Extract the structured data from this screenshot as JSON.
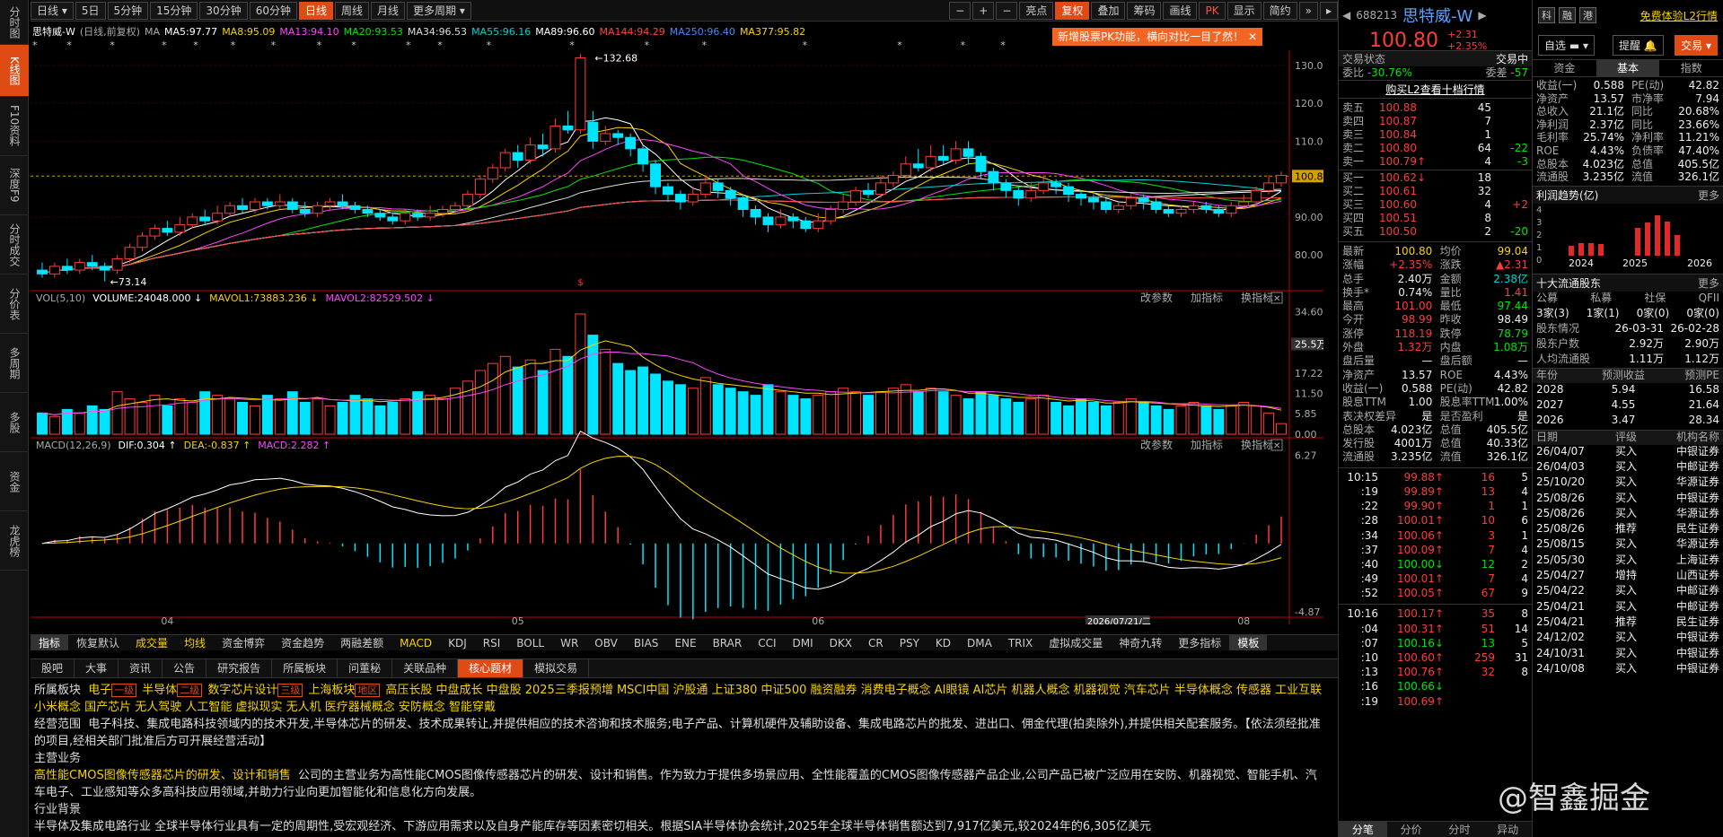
{
  "left_rail": [
    "分时图",
    "K线图",
    "F10资料",
    "深度F9",
    "分时成交",
    "分价表",
    "多周期",
    "多股",
    "资金",
    "龙虎榜"
  ],
  "toolbar": {
    "items": [
      "日线",
      "5日",
      "5分钟",
      "15分钟",
      "30分钟",
      "60分钟",
      "日线",
      "周线",
      "月线",
      "更多周期"
    ],
    "right": [
      "亮点",
      "复权",
      "叠加",
      "筹码",
      "画线",
      "PK",
      "显示",
      "简约"
    ]
  },
  "period_select": "日线",
  "stock": {
    "code": "688213",
    "name": "思特威-W",
    "price": "100.80",
    "change": "+2.31",
    "pct": "+2.35%"
  },
  "ma_line": [
    {
      "t": "思特威-W",
      "c": "#ffffff"
    },
    {
      "t": "(日线,前复权)",
      "c": "#aaaaaa"
    },
    {
      "t": "MA",
      "c": "#aaaaaa"
    },
    {
      "t": "MA5:97.77",
      "c": "#ffffff"
    },
    {
      "t": "MA8:95.09",
      "c": "#f5d300"
    },
    {
      "t": "MA13:94.10",
      "c": "#ff44ff"
    },
    {
      "t": "MA20:93.53",
      "c": "#00e600"
    },
    {
      "t": "MA34:96.53",
      "c": "#dddddd"
    },
    {
      "t": "MA55:96.16",
      "c": "#00d5d5"
    },
    {
      "t": "MA89:96.60",
      "c": "#ffffff"
    },
    {
      "t": "MA144:94.29",
      "c": "#ff4444"
    },
    {
      "t": "MA250:96.40",
      "c": "#4488ff"
    },
    {
      "t": "MA377:95.82",
      "c": "#f5d300"
    }
  ],
  "tip": "新增股票PK功能，横向对比一目了然！",
  "price_axis": [
    "130.00",
    "120.00",
    "110.00",
    "100.80",
    "90.00",
    "80.00"
  ],
  "hi_label": "132.68",
  "lo_label": "73.14",
  "vol_head": {
    "name": "VOL(5,10)",
    "volume": "VOLUME:24048.000",
    "m1": "MAVOL1:73883.236",
    "m2": "MAVOL2:82529.502"
  },
  "vol_axis": [
    "34.60",
    "25.5万",
    "17.22",
    "11.50",
    "5.85",
    "0.00"
  ],
  "macd_head": {
    "name": "MACD(12,26,9)",
    "dif": "DIF:0.304",
    "dea": "DEA:-0.837",
    "macd": "MACD:2.282"
  },
  "macd_axis": [
    "6.27",
    "-4.87"
  ],
  "panel_btns": [
    "改参数",
    "加指标",
    "换指标"
  ],
  "x_axis": [
    "04",
    "05",
    "06",
    "07",
    "08"
  ],
  "cursor_date": "2026/07/21/二",
  "chart_data": {
    "type": "candlestick",
    "ylim": [
      72,
      134
    ],
    "candles": [
      [
        76,
        75,
        78,
        74
      ],
      [
        75,
        77,
        78,
        74
      ],
      [
        77,
        76,
        79,
        75
      ],
      [
        76,
        78,
        79,
        75
      ],
      [
        78,
        77,
        80,
        76
      ],
      [
        77,
        76,
        78,
        73
      ],
      [
        76,
        79,
        80,
        75
      ],
      [
        79,
        82,
        83,
        78
      ],
      [
        82,
        85,
        86,
        81
      ],
      [
        85,
        87,
        88,
        84
      ],
      [
        87,
        86,
        89,
        85
      ],
      [
        86,
        88,
        90,
        85
      ],
      [
        88,
        90,
        91,
        87
      ],
      [
        90,
        89,
        92,
        88
      ],
      [
        89,
        91,
        93,
        88
      ],
      [
        91,
        93,
        94,
        90
      ],
      [
        93,
        92,
        95,
        91
      ],
      [
        92,
        94,
        95,
        91
      ],
      [
        94,
        93,
        95,
        92
      ],
      [
        93,
        94,
        96,
        92
      ],
      [
        94,
        92,
        95,
        91
      ],
      [
        92,
        91,
        94,
        90
      ],
      [
        91,
        93,
        94,
        90
      ],
      [
        93,
        94,
        95,
        92
      ],
      [
        94,
        93,
        96,
        92
      ],
      [
        93,
        92,
        94,
        91
      ],
      [
        92,
        91,
        93,
        90
      ],
      [
        91,
        90,
        92,
        89
      ],
      [
        90,
        89,
        91,
        88
      ],
      [
        89,
        91,
        92,
        88
      ],
      [
        91,
        90,
        92,
        89
      ],
      [
        90,
        91,
        93,
        89
      ],
      [
        91,
        92,
        93,
        90
      ],
      [
        92,
        93,
        94,
        91
      ],
      [
        93,
        96,
        97,
        92
      ],
      [
        96,
        100,
        101,
        95
      ],
      [
        100,
        103,
        104,
        99
      ],
      [
        103,
        107,
        108,
        102
      ],
      [
        107,
        105,
        109,
        103
      ],
      [
        105,
        109,
        111,
        104
      ],
      [
        109,
        108,
        112,
        106
      ],
      [
        108,
        114,
        116,
        107
      ],
      [
        114,
        113,
        118,
        112
      ],
      [
        113,
        132,
        133,
        112
      ],
      [
        115,
        110,
        118,
        108
      ],
      [
        110,
        112,
        114,
        109
      ],
      [
        112,
        111,
        113,
        109
      ],
      [
        111,
        108,
        112,
        106
      ],
      [
        108,
        104,
        109,
        102
      ],
      [
        104,
        98,
        105,
        96
      ],
      [
        98,
        96,
        99,
        94
      ],
      [
        96,
        94,
        97,
        92
      ],
      [
        94,
        96,
        98,
        93
      ],
      [
        96,
        99,
        101,
        95
      ],
      [
        99,
        97,
        100,
        95
      ],
      [
        97,
        95,
        98,
        93
      ],
      [
        95,
        92,
        96,
        90
      ],
      [
        92,
        90,
        93,
        88
      ],
      [
        90,
        88,
        91,
        86
      ],
      [
        88,
        90,
        92,
        87
      ],
      [
        90,
        89,
        91,
        87
      ],
      [
        89,
        87,
        90,
        86
      ],
      [
        87,
        89,
        91,
        86
      ],
      [
        89,
        92,
        93,
        88
      ],
      [
        92,
        94,
        96,
        91
      ],
      [
        94,
        97,
        98,
        93
      ],
      [
        97,
        96,
        99,
        95
      ],
      [
        96,
        99,
        101,
        95
      ],
      [
        99,
        101,
        102,
        98
      ],
      [
        101,
        104,
        106,
        100
      ],
      [
        104,
        103,
        108,
        102
      ],
      [
        103,
        106,
        109,
        102
      ],
      [
        106,
        105,
        109,
        104
      ],
      [
        105,
        108,
        110,
        104
      ],
      [
        108,
        106,
        110,
        104
      ],
      [
        106,
        102,
        107,
        100
      ],
      [
        102,
        99,
        103,
        97
      ],
      [
        99,
        97,
        100,
        95
      ],
      [
        97,
        95,
        98,
        93
      ],
      [
        95,
        97,
        99,
        94
      ],
      [
        97,
        99,
        101,
        96
      ],
      [
        99,
        98,
        100,
        96
      ],
      [
        98,
        96,
        99,
        94
      ],
      [
        96,
        95,
        97,
        93
      ],
      [
        95,
        94,
        96,
        92
      ],
      [
        94,
        92,
        95,
        91
      ],
      [
        92,
        93,
        94,
        91
      ],
      [
        93,
        95,
        96,
        92
      ],
      [
        95,
        94,
        96,
        92
      ],
      [
        94,
        92,
        95,
        91
      ],
      [
        92,
        91,
        93,
        90
      ],
      [
        91,
        92,
        93,
        90
      ],
      [
        92,
        93,
        94,
        91
      ],
      [
        93,
        92,
        94,
        91
      ],
      [
        92,
        91,
        93,
        90
      ],
      [
        91,
        93,
        94,
        90
      ],
      [
        93,
        94,
        96,
        92
      ],
      [
        94,
        97,
        98,
        93
      ],
      [
        97,
        99,
        101,
        96
      ],
      [
        99,
        101,
        102,
        98
      ]
    ],
    "vol": [
      6,
      5,
      7,
      6,
      8,
      7,
      12,
      10,
      9,
      11,
      8,
      10,
      9,
      12,
      11,
      10,
      9,
      8,
      11,
      10,
      12,
      9,
      10,
      8,
      9,
      11,
      10,
      8,
      9,
      10,
      12,
      11,
      10,
      13,
      15,
      18,
      20,
      22,
      19,
      21,
      18,
      24,
      22,
      34,
      28,
      24,
      20,
      18,
      19,
      17,
      15,
      14,
      13,
      16,
      14,
      13,
      12,
      11,
      14,
      12,
      11,
      10,
      11,
      12,
      13,
      12,
      11,
      12,
      13,
      14,
      12,
      13,
      12,
      11,
      10,
      12,
      11,
      10,
      9,
      10,
      11,
      9,
      8,
      10,
      9,
      8,
      9,
      10,
      9,
      8,
      7,
      8,
      9,
      8,
      7,
      8,
      9,
      8,
      6,
      3
    ],
    "vol_ylim": [
      0,
      35
    ],
    "macd_ylim": [
      -5,
      6.5
    ]
  },
  "rp1": {
    "tabs": [
      "交易状态",
      "交易中"
    ],
    "weibi": {
      "k": "委比",
      "v": "-30.76%",
      "k2": "委差",
      "v2": "-57"
    },
    "buyl2": "购买L2查看十档行情",
    "asks": [
      [
        "卖五",
        "100.88",
        "45",
        ""
      ],
      [
        "卖四",
        "100.87",
        "7",
        ""
      ],
      [
        "卖三",
        "100.84",
        "1",
        ""
      ],
      [
        "卖二",
        "100.80",
        "64",
        "-22"
      ],
      [
        "卖一",
        "100.79↑",
        "4",
        "-3"
      ]
    ],
    "bids": [
      [
        "买一",
        "100.62↓",
        "18",
        ""
      ],
      [
        "买二",
        "100.61",
        "32",
        ""
      ],
      [
        "买三",
        "100.60",
        "4",
        "+2"
      ],
      [
        "买四",
        "100.51",
        "8",
        ""
      ],
      [
        "买五",
        "100.50",
        "2",
        "-20"
      ]
    ],
    "stats": [
      [
        "最新",
        "100.80",
        "均价",
        "99.04"
      ],
      [
        "涨幅",
        "+2.35%",
        "涨跌",
        "▲2.31"
      ],
      [
        "总手",
        "2.40万",
        "金额",
        "2.38亿"
      ],
      [
        "换手*",
        "0.74%",
        "量比",
        "1.41"
      ],
      [
        "最高",
        "101.00",
        "最低",
        "97.44"
      ],
      [
        "今开",
        "98.99",
        "昨收",
        "98.49"
      ],
      [
        "涨停",
        "118.19",
        "跌停",
        "78.79"
      ],
      [
        "外盘",
        "1.32万",
        "内盘",
        "1.08万"
      ],
      [
        "盘后量",
        "—",
        "盘后额",
        "—"
      ],
      [
        "净资产",
        "13.57",
        "ROE",
        "4.43%"
      ],
      [
        "收益(一)",
        "0.588",
        "PE(动)",
        "42.82"
      ],
      [
        "股息TTM",
        "1.00",
        "股息率TTM",
        "1.00%"
      ],
      [
        "表决权差异",
        "是",
        "是否盈利",
        "是"
      ],
      [
        "总股本",
        "4.023亿",
        "总值",
        "405.5亿"
      ],
      [
        "发行股",
        "4001万",
        "总值",
        "40.33亿"
      ],
      [
        "流通股",
        "3.235亿",
        "流值",
        "326.1亿"
      ]
    ],
    "ticks1": [
      [
        "10:15",
        "99.88↑",
        "16",
        "5"
      ],
      [
        ":19",
        "99.89↑",
        "13",
        "4"
      ],
      [
        ":22",
        "99.90↑",
        "1",
        "1"
      ],
      [
        ":28",
        "100.01↑",
        "10",
        "6"
      ],
      [
        ":34",
        "100.06↑",
        "3",
        "1"
      ],
      [
        ":37",
        "100.09↑",
        "7",
        "4"
      ],
      [
        ":40",
        "100.00↓",
        "12",
        "2"
      ],
      [
        ":49",
        "100.01↑",
        "7",
        "4"
      ],
      [
        ":52",
        "100.05↑",
        "67",
        "9"
      ]
    ],
    "ticks2": [
      [
        "10:16",
        "100.17↑",
        "35",
        "8"
      ],
      [
        ":04",
        "100.31↑",
        "51",
        "14"
      ],
      [
        ":07",
        "100.16↓",
        "13",
        "5"
      ],
      [
        ":10",
        "100.60↑",
        "259",
        "31"
      ],
      [
        ":13",
        "100.76↑",
        "32",
        "8"
      ],
      [
        ":16",
        "100.66↓",
        "",
        ""
      ],
      [
        ":19",
        "100.69↑",
        "",
        ""
      ]
    ],
    "bottom_tabs": [
      "分笔",
      "分价",
      "分时",
      "异动"
    ]
  },
  "rp2": {
    "top": [
      "科",
      "融",
      "港",
      "免费体验L2行情"
    ],
    "btns": [
      "自选",
      "提醒",
      "交易"
    ],
    "tabs": [
      "资金",
      "基本",
      "指数"
    ],
    "fund": [
      [
        "收益(一)",
        "0.588",
        "PE(动)",
        "42.82"
      ],
      [
        "净资产",
        "13.57",
        "市净率",
        "7.94"
      ],
      [
        "总收入",
        "21.1亿",
        "同比",
        "20.68%"
      ],
      [
        "净利润",
        "2.37亿",
        "同比",
        "23.66%"
      ],
      [
        "毛利率",
        "25.74%",
        "净利率",
        "11.21%"
      ],
      [
        "ROE",
        "4.43%",
        "负债率",
        "47.40%"
      ],
      [
        "总股本",
        "4.023亿",
        "总值",
        "405.5亿"
      ],
      [
        "流通股",
        "3.235亿",
        "流值",
        "326.1亿"
      ]
    ],
    "profit_title": "利润趋势(亿)",
    "more": "更多",
    "profit_axis": [
      "4",
      "3",
      "2",
      "1",
      "0"
    ],
    "profit_years": [
      "2024",
      "2025",
      "2026"
    ],
    "profit_bars": [
      0.8,
      1.0,
      1.0,
      0.9,
      2.2,
      2.6,
      3.2,
      2.7,
      1.6
    ],
    "holders_title": "十大流通股东",
    "holder_tabs": [
      "公募",
      "私募",
      "社保",
      "QFII"
    ],
    "holder_vals": [
      "3家(3)",
      "1家(1)",
      "0家(0)",
      "0家(0)"
    ],
    "holder_rows": [
      [
        "股东情况",
        "26-03-31",
        "26-02-28"
      ],
      [
        "股东户数",
        "2.92万",
        "2.90万"
      ],
      [
        "人均流通股",
        "1.11万",
        "1.12万"
      ]
    ],
    "fc_head": [
      "年份",
      "预测收益",
      "预测PE"
    ],
    "fc": [
      [
        "2028",
        "5.94",
        "16.58"
      ],
      [
        "2027",
        "4.55",
        "21.64"
      ],
      [
        "2026",
        "3.47",
        "28.34"
      ]
    ],
    "rate_head": [
      "日期",
      "评级",
      "机构名称"
    ],
    "rates": [
      [
        "26/04/07",
        "买入",
        "中银证券"
      ],
      [
        "26/04/03",
        "买入",
        "中邮证券"
      ],
      [
        "25/10/20",
        "买入",
        "华源证券"
      ],
      [
        "25/08/26",
        "买入",
        "中银证券"
      ],
      [
        "25/08/26",
        "买入",
        "华源证券"
      ],
      [
        "25/08/26",
        "推荐",
        "民生证券"
      ],
      [
        "25/08/15",
        "买入",
        "华源证券"
      ],
      [
        "25/05/30",
        "买入",
        "上海证券"
      ],
      [
        "25/04/27",
        "增持",
        "山西证券"
      ],
      [
        "25/04/22",
        "买入",
        "中邮证券"
      ],
      [
        "25/04/21",
        "买入",
        "中邮证券"
      ],
      [
        "25/04/21",
        "推荐",
        "民生证券"
      ],
      [
        "24/12/02",
        "买入",
        "中银证券"
      ],
      [
        "24/10/31",
        "买入",
        "中银证券"
      ],
      [
        "24/10/08",
        "买入",
        "中银证券"
      ]
    ]
  },
  "ind_tabs": [
    "指标",
    "恢复默认",
    "成交量",
    "均线",
    "资金博弈",
    "资金趋势",
    "两融差额",
    "MACD",
    "KDJ",
    "RSI",
    "BOLL",
    "WR",
    "OBV",
    "BIAS",
    "ENE",
    "BRAR",
    "CCI",
    "DMI",
    "DKX",
    "CR",
    "PSY",
    "KD",
    "DMA",
    "TRIX",
    "虚拟成交量",
    "神奇九转",
    "更多指标",
    "模板"
  ],
  "info_tabs": [
    "股吧",
    "大事",
    "资讯",
    "公告",
    "研究报告",
    "所属板块",
    "问董秘",
    "关联品种",
    "核心题材",
    "模拟交易"
  ],
  "info": {
    "l1_label": "所属板块",
    "tags": [
      [
        "电子",
        "一级"
      ],
      [
        "半导体",
        "二级"
      ],
      [
        "数字芯片设计",
        "三级"
      ],
      [
        "上海板块",
        "地区"
      ]
    ],
    "concepts": "高压长股 中盘成长 中盘股 2025三季报预增 MSCI中国 沪股通 上证380 中证500 融资融券 消费电子概念 AI眼镜 AI芯片 机器人概念 机器视觉 汽车芯片 半导体概念 传感器 工业互联 小米概念 国产芯片 无人驾驶 人工智能 虚拟现实 无人机 医疗器械概念 安防概念 智能穿戴",
    "scope_label": "经营范围",
    "scope": "电子科技、集成电路科技领域内的技术开发,半导体芯片的研发、技术成果转让,并提供相应的技术咨询和技术服务;电子产品、计算机硬件及辅助设备、集成电路芯片的批发、进出口、佣金代理(拍卖除外),并提供相关配套服务。【依法须经批准的项目,经相关部门批准后方可开展经营活动】",
    "main_label": "主营业务",
    "main_y": "高性能CMOS图像传感器芯片的研发、设计和销售",
    "main_w": "公司的主营业务为高性能CMOS图像传感器芯片的研发、设计和销售。作为致力于提供多场景应用、全性能覆盖的CMOS图像传感器产品企业,公司产品已被广泛应用在安防、机器视觉、智能手机、汽车电子、工业感知等众多高科技应用领域,并助力行业向更加智能化和信息化方向发展。",
    "bg_label": "行业背景",
    "bg": "半导体及集成电路行业 全球半导体行业具有一定的周期性,受宏观经济、下游应用需求以及自身产能库存等因素密切相关。根据SIA半导体协会统计,2025年全球半导体销售额达到7,917亿美元,较2024年的6,305亿美元"
  },
  "watermark": "@智鑫掘金"
}
